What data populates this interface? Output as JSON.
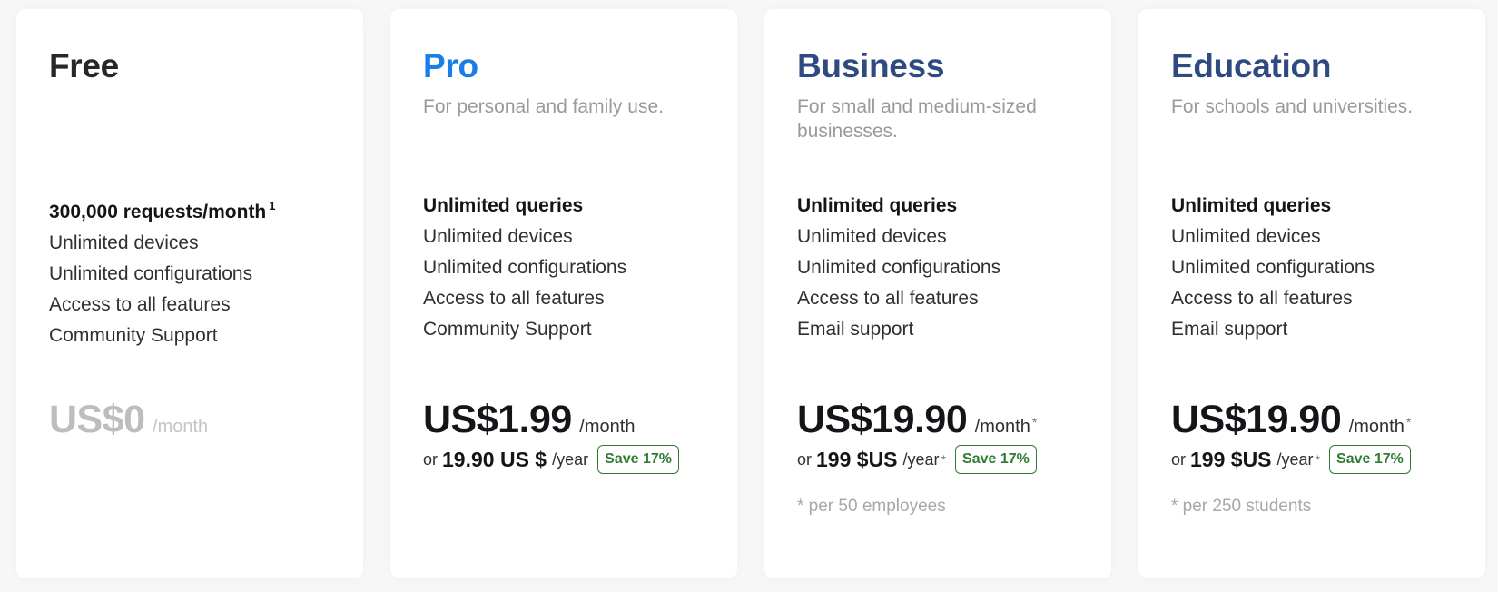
{
  "plans": [
    {
      "name": "Free",
      "name_color": "#25272b",
      "description": "",
      "features": [
        {
          "text": "300,000 requests/month",
          "bold": true,
          "footnote": "1"
        },
        {
          "text": "Unlimited devices",
          "bold": false
        },
        {
          "text": "Unlimited configurations",
          "bold": false
        },
        {
          "text": "Access to all features",
          "bold": false
        },
        {
          "text": "Community Support",
          "bold": false
        }
      ],
      "price": "US$0",
      "period": "/month",
      "muted": true
    },
    {
      "name": "Pro",
      "name_color": "#1a7ee8",
      "description": "For personal and family use.",
      "features": [
        {
          "text": "Unlimited queries",
          "bold": true
        },
        {
          "text": "Unlimited devices",
          "bold": false
        },
        {
          "text": "Unlimited configurations",
          "bold": false
        },
        {
          "text": "Access to all features",
          "bold": false
        },
        {
          "text": "Community Support",
          "bold": false
        }
      ],
      "price": "US$1.99",
      "period": "/month",
      "period_star": "",
      "or_label": "or",
      "yearly_price": "19.90 US $",
      "yearly_period": "/year",
      "yearly_star": "",
      "badge": "Save 17%"
    },
    {
      "name": "Business",
      "name_color": "#2f4a80",
      "description": "For small and medium-sized businesses.",
      "features": [
        {
          "text": "Unlimited queries",
          "bold": true
        },
        {
          "text": "Unlimited devices",
          "bold": false
        },
        {
          "text": "Unlimited configurations",
          "bold": false
        },
        {
          "text": "Access to all features",
          "bold": false
        },
        {
          "text": "Email support",
          "bold": false
        }
      ],
      "price": "US$19.90",
      "period": "/month",
      "period_star": "*",
      "or_label": "or",
      "yearly_price": "199 $US",
      "yearly_period": "/year",
      "yearly_star": "*",
      "badge": "Save 17%",
      "note": "* per 50 employees"
    },
    {
      "name": "Education",
      "name_color": "#2f4a80",
      "description": "For schools and universities.",
      "features": [
        {
          "text": "Unlimited queries",
          "bold": true
        },
        {
          "text": "Unlimited devices",
          "bold": false
        },
        {
          "text": "Unlimited configurations",
          "bold": false
        },
        {
          "text": "Access to all features",
          "bold": false
        },
        {
          "text": "Email support",
          "bold": false
        }
      ],
      "price": "US$19.90",
      "period": "/month",
      "period_star": "*",
      "or_label": "or",
      "yearly_price": "199 $US",
      "yearly_period": "/year",
      "yearly_star": "*",
      "badge": "Save 17%",
      "note": "* per 250 students"
    }
  ],
  "colors": {
    "badge_green": "#2e7d32",
    "muted_price": "#bdbdbf"
  }
}
